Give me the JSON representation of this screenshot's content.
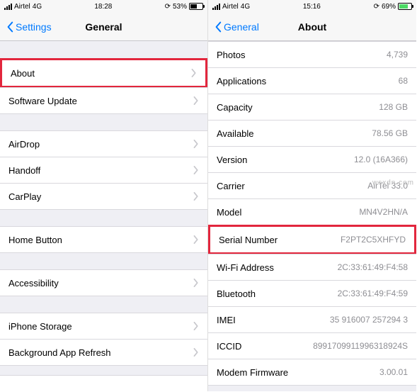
{
  "left": {
    "status": {
      "carrier": "Airtel",
      "network": "4G",
      "time": "18:28",
      "battery_pct": "53%"
    },
    "nav": {
      "back": "Settings",
      "title": "General"
    },
    "rows": {
      "about": "About",
      "software_update": "Software Update",
      "airdrop": "AirDrop",
      "handoff": "Handoff",
      "carplay": "CarPlay",
      "home_button": "Home Button",
      "accessibility": "Accessibility",
      "iphone_storage": "iPhone Storage",
      "background_app_refresh": "Background App Refresh"
    }
  },
  "right": {
    "status": {
      "carrier": "Airtel",
      "network": "4G",
      "time": "15:16",
      "battery_pct": "69%"
    },
    "nav": {
      "back": "General",
      "title": "About"
    },
    "rows": [
      {
        "label": "Photos",
        "value": "4,739"
      },
      {
        "label": "Applications",
        "value": "68"
      },
      {
        "label": "Capacity",
        "value": "128 GB"
      },
      {
        "label": "Available",
        "value": "78.56 GB"
      },
      {
        "label": "Version",
        "value": "12.0 (16A366)"
      },
      {
        "label": "Carrier",
        "value": "AirTel 33.0"
      },
      {
        "label": "Model",
        "value": "MN4V2HN/A"
      },
      {
        "label": "Serial Number",
        "value": "F2PT2C5XHFYD"
      },
      {
        "label": "Wi-Fi Address",
        "value": "2C:33:61:49:F4:58"
      },
      {
        "label": "Bluetooth",
        "value": "2C:33:61:49:F4:59"
      },
      {
        "label": "IMEI",
        "value": "35 916007 257294 3"
      },
      {
        "label": "ICCID",
        "value": "8991709911996318924S"
      },
      {
        "label": "Modem Firmware",
        "value": "3.00.01"
      }
    ]
  },
  "watermark": "wsxdn.com"
}
